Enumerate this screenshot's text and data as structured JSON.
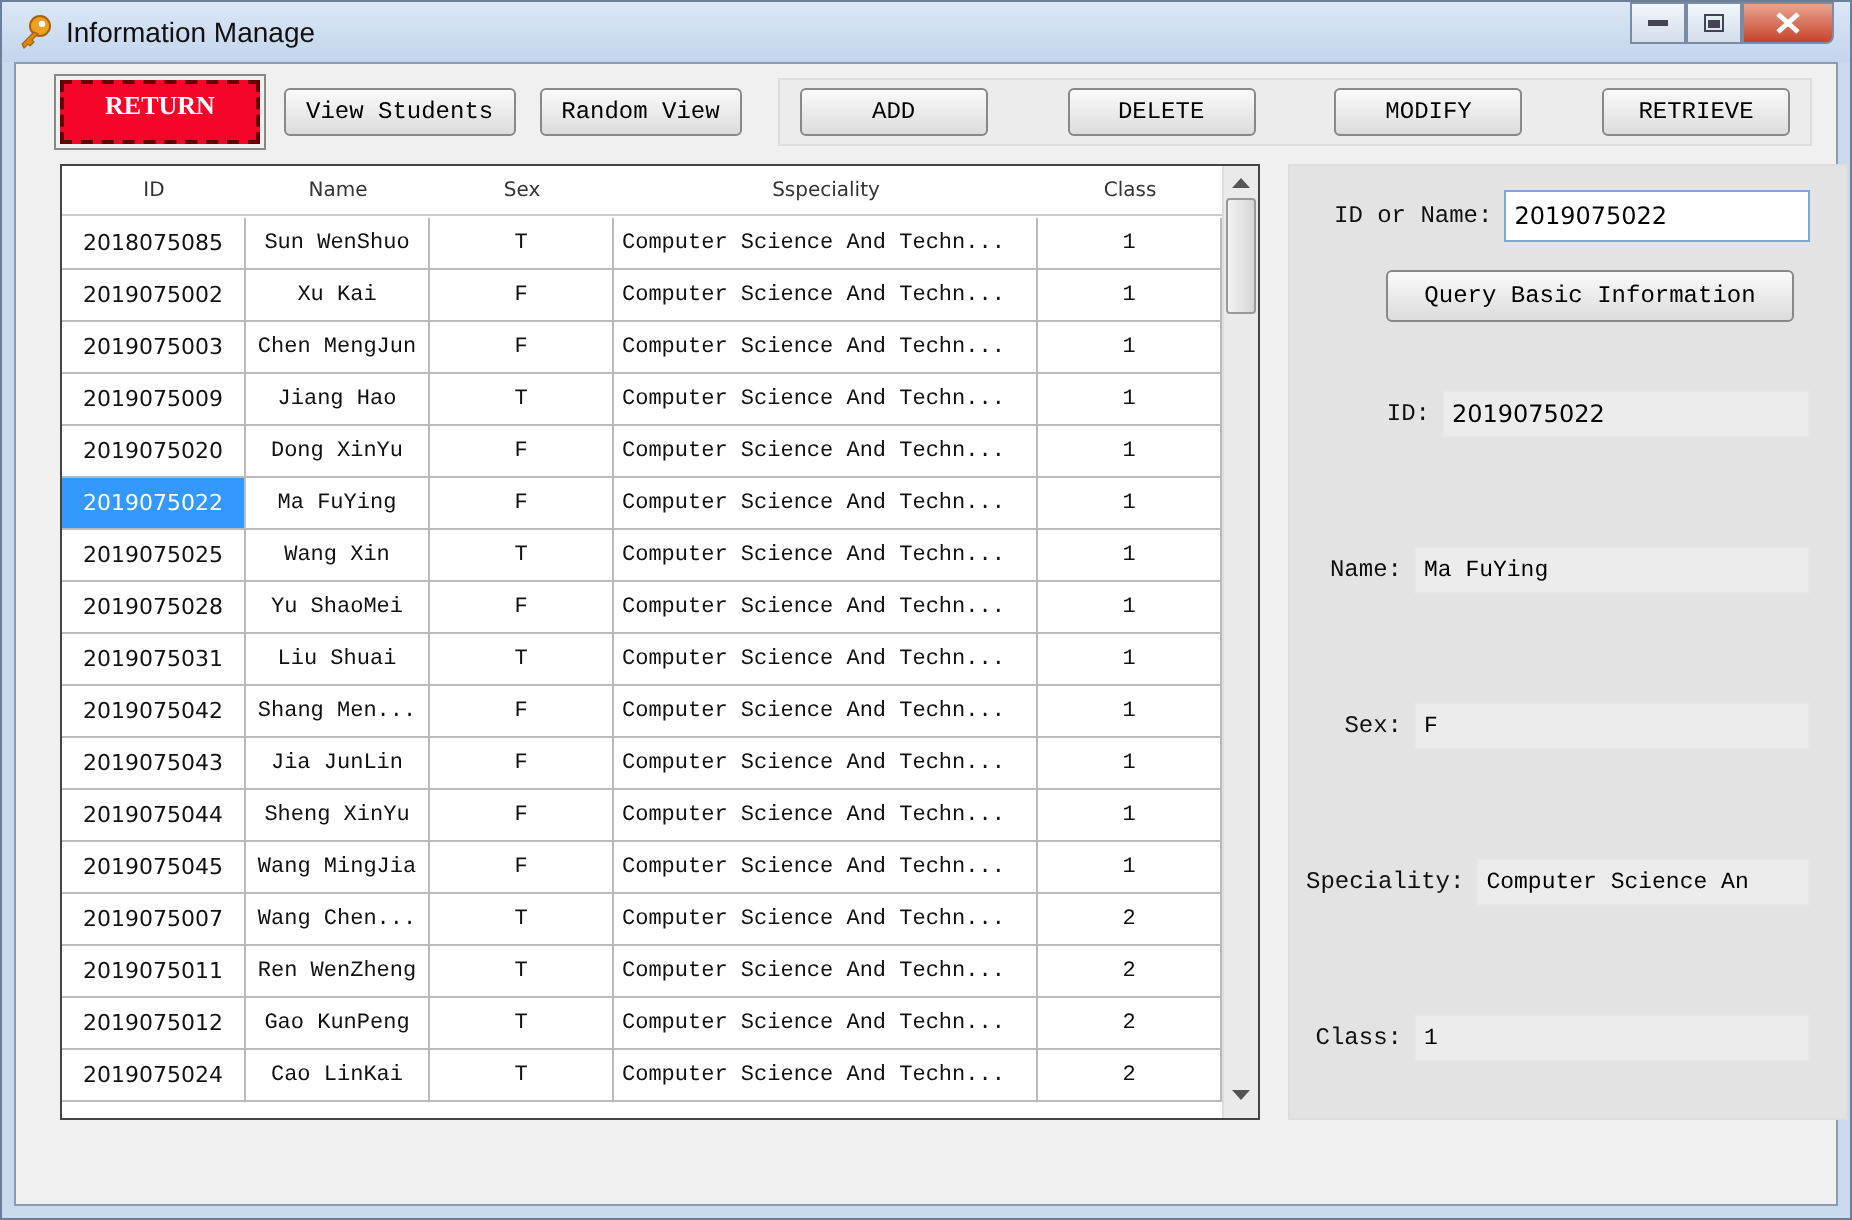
{
  "window": {
    "title": "Information Manage"
  },
  "toolbar": {
    "left_buttons": [
      {
        "label": "RETURN",
        "kind": "alert"
      },
      {
        "label": "View Students",
        "kind": "plain"
      },
      {
        "label": "Random View",
        "kind": "plain"
      }
    ],
    "actions": [
      "ADD",
      "DELETE",
      "MODIFY",
      "RETRIEVE"
    ]
  },
  "table": {
    "columns": [
      "ID",
      "Name",
      "Sex",
      "Sspeciality",
      "Class"
    ],
    "rows": [
      {
        "cells": [
          "2018075085",
          "Sun WenShuo",
          "T",
          "Computer Science And Techn...",
          "1"
        ],
        "selected": false
      },
      {
        "cells": [
          "2019075002",
          "Xu Kai",
          "F",
          "Computer Science And Techn...",
          "1"
        ],
        "selected": false
      },
      {
        "cells": [
          "2019075003",
          "Chen MengJun",
          "F",
          "Computer Science And Techn...",
          "1"
        ],
        "selected": false
      },
      {
        "cells": [
          "2019075009",
          "Jiang Hao",
          "T",
          "Computer Science And Techn...",
          "1"
        ],
        "selected": false
      },
      {
        "cells": [
          "2019075020",
          "Dong XinYu",
          "F",
          "Computer Science And Techn...",
          "1"
        ],
        "selected": false
      },
      {
        "cells": [
          "2019075022",
          "Ma FuYing",
          "F",
          "Computer Science And Techn...",
          "1"
        ],
        "selected": true
      },
      {
        "cells": [
          "2019075025",
          "Wang Xin",
          "T",
          "Computer Science And Techn...",
          "1"
        ],
        "selected": false
      },
      {
        "cells": [
          "2019075028",
          "Yu ShaoMei",
          "F",
          "Computer Science And Techn...",
          "1"
        ],
        "selected": false
      },
      {
        "cells": [
          "2019075031",
          "Liu Shuai",
          "T",
          "Computer Science And Techn...",
          "1"
        ],
        "selected": false
      },
      {
        "cells": [
          "2019075042",
          "Shang Men...",
          "F",
          "Computer Science And Techn...",
          "1"
        ],
        "selected": false
      },
      {
        "cells": [
          "2019075043",
          "Jia JunLin",
          "F",
          "Computer Science And Techn...",
          "1"
        ],
        "selected": false
      },
      {
        "cells": [
          "2019075044",
          "Sheng XinYu",
          "F",
          "Computer Science And Techn...",
          "1"
        ],
        "selected": false
      },
      {
        "cells": [
          "2019075045",
          "Wang MingJia",
          "F",
          "Computer Science And Techn...",
          "1"
        ],
        "selected": false
      },
      {
        "cells": [
          "2019075007",
          "Wang Chen...",
          "T",
          "Computer Science And Techn...",
          "2"
        ],
        "selected": false
      },
      {
        "cells": [
          "2019075011",
          "Ren WenZheng",
          "T",
          "Computer Science And Techn...",
          "2"
        ],
        "selected": false
      },
      {
        "cells": [
          "2019075012",
          "Gao KunPeng",
          "T",
          "Computer Science And Techn...",
          "2"
        ],
        "selected": false
      },
      {
        "cells": [
          "2019075024",
          "Cao LinKai",
          "T",
          "Computer Science And Techn...",
          "2"
        ],
        "selected": false
      }
    ]
  },
  "query": {
    "label": "ID or Name:",
    "value": "2019075022",
    "button": "Query Basic Information"
  },
  "details": [
    {
      "label": "ID:",
      "value": "2019075022",
      "kind": "sans"
    },
    {
      "label": "Name:",
      "value": "Ma FuYing",
      "kind": "mono"
    },
    {
      "label": "Sex:",
      "value": "F",
      "kind": "mono"
    },
    {
      "label": "Speciality:",
      "value": "Computer Science An",
      "kind": "mono"
    },
    {
      "label": "Class:",
      "value": "1",
      "kind": "mono"
    }
  ]
}
